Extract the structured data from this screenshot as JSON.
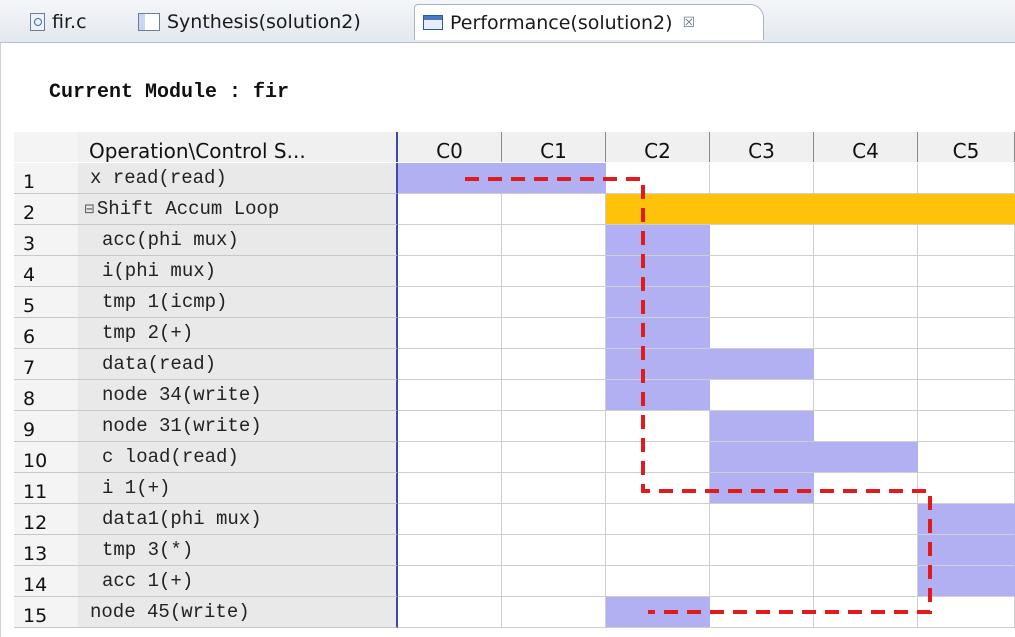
{
  "tabs": [
    {
      "label": "fir.c",
      "icon": "c-file-icon",
      "active": false
    },
    {
      "label": "Synthesis(solution2)",
      "icon": "synthesis-report-icon",
      "active": false
    },
    {
      "label": "Performance(solution2)",
      "icon": "performance-view-icon",
      "active": true,
      "close": "☒"
    }
  ],
  "module": {
    "label": "Current Module : fir"
  },
  "table": {
    "op_header": "Operation\\Control S...",
    "steps": [
      "C0",
      "C1",
      "C2",
      "C3",
      "C4",
      "C5"
    ],
    "rows": [
      {
        "num": "1",
        "label": "x read(read)",
        "indent": 1,
        "loop": false,
        "active_steps": [
          "C0",
          "C1"
        ]
      },
      {
        "num": "2",
        "label": "Shift Accum Loop",
        "indent": 0,
        "loop": true,
        "active_steps": [
          "C2",
          "C3",
          "C4",
          "C5"
        ],
        "expander": "⊟"
      },
      {
        "num": "3",
        "label": "acc(phi mux)",
        "indent": 3,
        "loop": false,
        "active_steps": [
          "C2"
        ]
      },
      {
        "num": "4",
        "label": "i(phi mux)",
        "indent": 3,
        "loop": false,
        "active_steps": [
          "C2"
        ]
      },
      {
        "num": "5",
        "label": "tmp 1(icmp)",
        "indent": 3,
        "loop": false,
        "active_steps": [
          "C2"
        ]
      },
      {
        "num": "6",
        "label": "tmp 2(+)",
        "indent": 3,
        "loop": false,
        "active_steps": [
          "C2"
        ]
      },
      {
        "num": "7",
        "label": "data(read)",
        "indent": 3,
        "loop": false,
        "active_steps": [
          "C2",
          "C3"
        ]
      },
      {
        "num": "8",
        "label": "node 34(write)",
        "indent": 3,
        "loop": false,
        "active_steps": [
          "C2"
        ]
      },
      {
        "num": "9",
        "label": "node 31(write)",
        "indent": 3,
        "loop": false,
        "active_steps": [
          "C3"
        ]
      },
      {
        "num": "10",
        "label": "c load(read)",
        "indent": 3,
        "loop": false,
        "active_steps": [
          "C3",
          "C4"
        ]
      },
      {
        "num": "11",
        "label": "i 1(+)",
        "indent": 3,
        "loop": false,
        "active_steps": [
          "C3"
        ]
      },
      {
        "num": "12",
        "label": "data1(phi mux)",
        "indent": 3,
        "loop": false,
        "active_steps": [
          "C5"
        ]
      },
      {
        "num": "13",
        "label": "tmp 3(*)",
        "indent": 3,
        "loop": false,
        "active_steps": [
          "C5"
        ]
      },
      {
        "num": "14",
        "label": "acc 1(+)",
        "indent": 3,
        "loop": false,
        "active_steps": [
          "C5"
        ]
      },
      {
        "num": "15",
        "label": "node 45(write)",
        "indent": 1,
        "loop": false,
        "active_steps": [
          "C2"
        ]
      }
    ]
  },
  "colors": {
    "operation": "#b0b0f2",
    "loop": "#fdc209",
    "annotation_dashes": "#e01b1b",
    "op_column_border": "#3b49a8"
  }
}
